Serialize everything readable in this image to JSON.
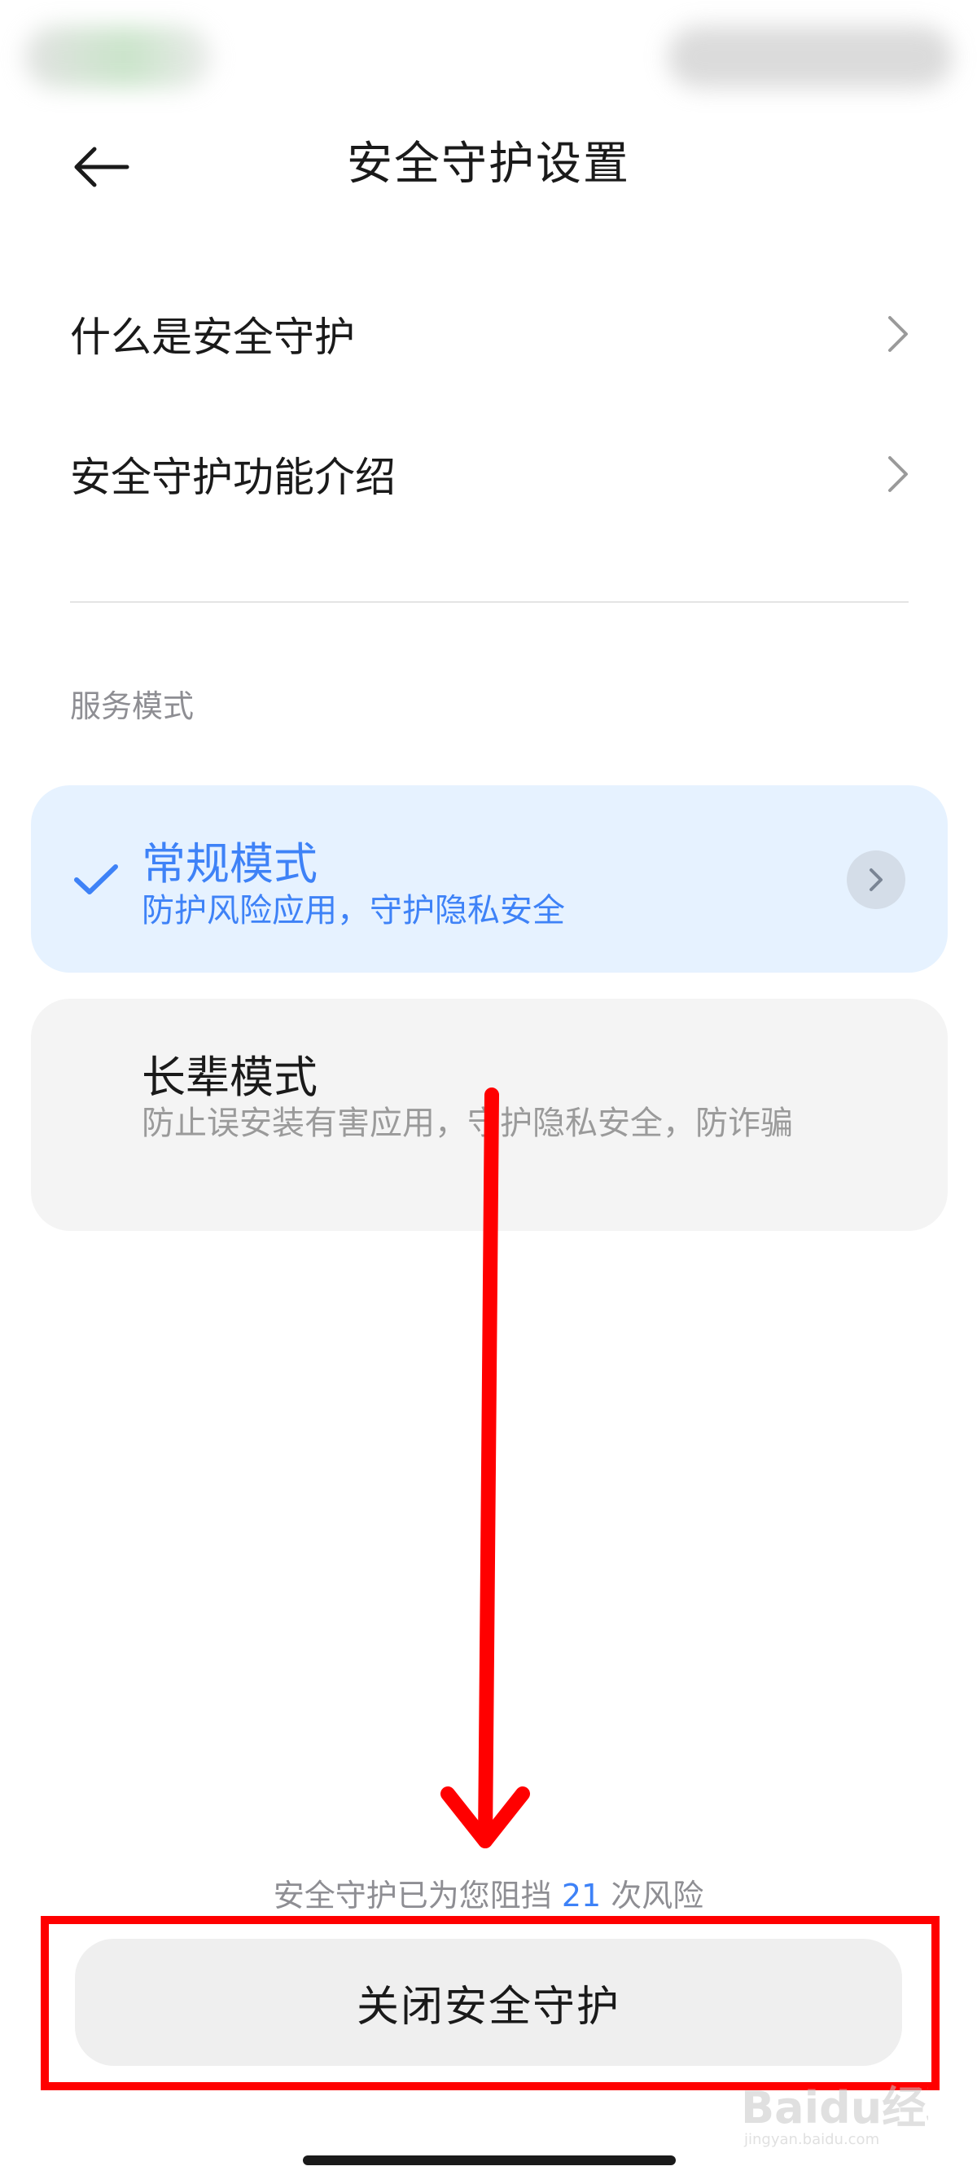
{
  "header": {
    "title": "安全守护设置"
  },
  "menu": {
    "items": [
      {
        "label": "什么是安全守护"
      },
      {
        "label": "安全守护功能介绍"
      }
    ]
  },
  "service_mode": {
    "section_label": "服务模式",
    "modes": [
      {
        "title": "常规模式",
        "description": "防护风险应用，守护隐私安全",
        "selected": true
      },
      {
        "title": "长辈模式",
        "description": "防止误安装有害应用，守护隐私安全，防诈骗",
        "selected": false
      }
    ]
  },
  "footer": {
    "block_prefix": "安全守护已为您阻挡",
    "block_count": "21",
    "block_suffix": "次风险",
    "close_button_label": "关闭安全守护"
  },
  "watermark": {
    "text": "Baidu经验",
    "subtext": "jingyan.baidu.com"
  },
  "colors": {
    "accent": "#3e82f7",
    "selected_card_bg": "#e6f2ff",
    "annotation": "#ff0000"
  }
}
